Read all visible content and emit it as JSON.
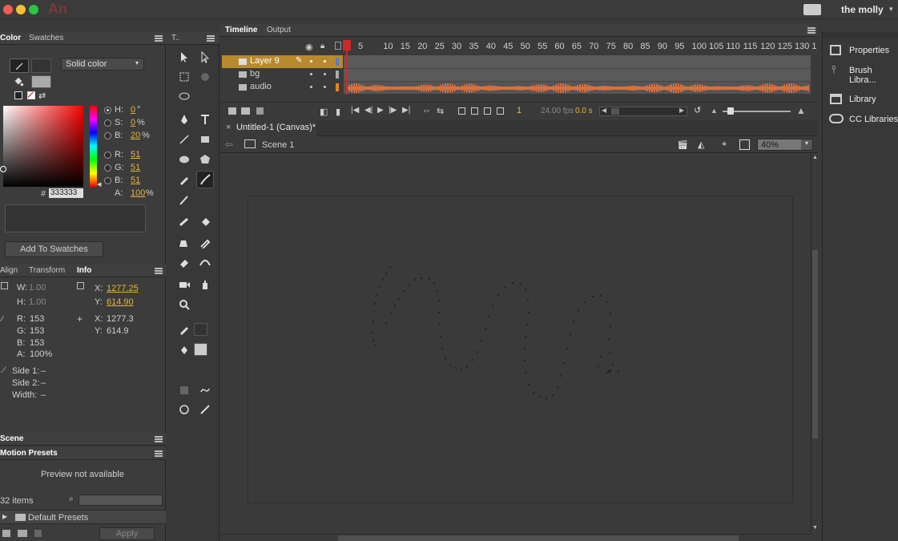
{
  "app": {
    "logo": "An",
    "user": "the molly"
  },
  "color_panel": {
    "tabs": [
      "Color",
      "Swatches"
    ],
    "fill_type": "Solid color",
    "fields": [
      {
        "label": "H:",
        "value": "0",
        "unit": "°"
      },
      {
        "label": "S:",
        "value": "0",
        "unit": "%"
      },
      {
        "label": "B:",
        "value": "20",
        "unit": "%"
      },
      {
        "label": "R:",
        "value": "51",
        "unit": ""
      },
      {
        "label": "G:",
        "value": "51",
        "unit": ""
      },
      {
        "label": "B:",
        "value": "51",
        "unit": ""
      },
      {
        "label": "A:",
        "value": "100",
        "unit": "%"
      }
    ],
    "hex_label": "#",
    "hex": "333333",
    "add_swatches": "Add To Swatches"
  },
  "info_panel": {
    "tabs": [
      "Align",
      "Transform",
      "Info"
    ],
    "w_label": "W:",
    "w": "1.00",
    "h_label": "H:",
    "h": "1.00",
    "x_label": "X:",
    "x": "1277.25",
    "y_label": "Y:",
    "y": "614.90",
    "r_label": "R:",
    "r": "153",
    "g_label": "G:",
    "g": "153",
    "b_label": "B:",
    "b": "153",
    "a_label": "A:",
    "a": "100%",
    "x2_label": "X:",
    "x2": "1277.3",
    "y2_label": "Y:",
    "y2": "614.9",
    "side1": "Side 1:",
    "side1_val": "–",
    "side2": "Side 2:",
    "side2_val": "–",
    "width": "Width:",
    "width_val": "–"
  },
  "scene_panel": {
    "title": "Scene"
  },
  "motion_presets": {
    "title": "Motion Presets",
    "preview": "Preview not available",
    "count": "32 items",
    "folder": "Default Presets",
    "apply": "Apply"
  },
  "timeline": {
    "tabs": [
      "Timeline",
      "Output"
    ],
    "frames": [
      "1",
      "5",
      "10",
      "15",
      "20",
      "25",
      "30",
      "35",
      "40",
      "45",
      "50",
      "55",
      "60",
      "65",
      "70",
      "75",
      "80",
      "85",
      "90",
      "95",
      "100",
      "105",
      "110",
      "115",
      "120",
      "125",
      "130",
      "1"
    ],
    "layers": [
      "Layer 9",
      "bg",
      "audio"
    ],
    "current_frame": "1",
    "fps": "24.00 fps",
    "time": "0.0 s"
  },
  "document": {
    "tab": "Untitled-1 (Canvas)*",
    "scene": "Scene 1",
    "zoom": "40%",
    "stage_color": "#999999"
  },
  "right_panels": [
    {
      "label": "Properties",
      "icon": "properties-icon"
    },
    {
      "label": "Brush Libra...",
      "icon": "brush-library-icon"
    },
    {
      "label": "Library",
      "icon": "library-icon"
    },
    {
      "label": "CC Libraries",
      "icon": "cc-libraries-icon"
    }
  ],
  "colors": {
    "accent": "#e5b33a",
    "playhead": "#cc2a2a",
    "waveform": "#d8703f",
    "layer_selected": "#b88a2d"
  }
}
